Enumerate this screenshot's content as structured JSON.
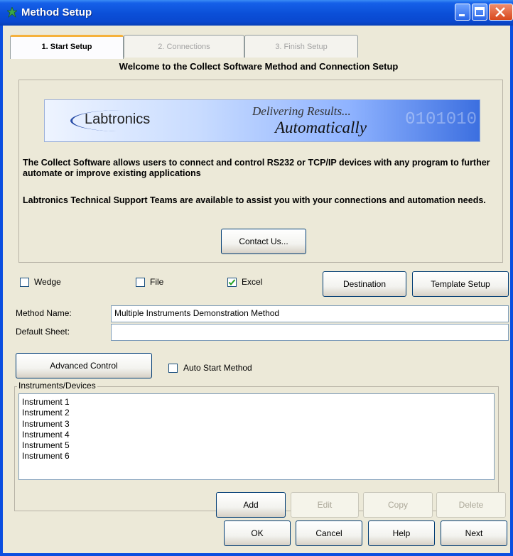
{
  "window": {
    "title": "Method Setup"
  },
  "tabs": [
    {
      "label": "1. Start Setup"
    },
    {
      "label": "2. Connections"
    },
    {
      "label": "3. Finish Setup"
    }
  ],
  "welcome": "Welcome to the Collect Software Method and Connection Setup",
  "banner": {
    "logo_text": "Labtronics",
    "tagline_1": "Delivering Results...",
    "tagline_2": "Automatically"
  },
  "info": {
    "paragraph_1": "The Collect Software allows users to connect and control RS232 or TCP/IP devices with any program to further automate or improve existing applications",
    "paragraph_2": "Labtronics Technical Support Teams are available to assist you with your connections and automation needs.",
    "contact_button": "Contact Us..."
  },
  "options": {
    "wedge_label": "Wedge",
    "wedge_checked": false,
    "file_label": "File",
    "file_checked": false,
    "excel_label": "Excel",
    "excel_checked": true,
    "destination_button": "Destination",
    "template_setup_button": "Template Setup"
  },
  "fields": {
    "method_name_label": "Method Name:",
    "method_name_value": "Multiple Instruments Demonstration Method",
    "default_sheet_label": "Default Sheet:",
    "default_sheet_value": ""
  },
  "advanced": {
    "advanced_button": "Advanced Control",
    "auto_start_label": "Auto Start Method",
    "auto_start_checked": false
  },
  "instruments": {
    "legend": "Instruments/Devices",
    "items": [
      "Instrument 1",
      "Instrument 2",
      "Instrument 3",
      "Instrument 4",
      "Instrument 5",
      "Instrument 6"
    ],
    "add_button": "Add",
    "edit_button": "Edit",
    "copy_button": "Copy",
    "delete_button": "Delete"
  },
  "footer": {
    "ok_button": "OK",
    "cancel_button": "Cancel",
    "help_button": "Help",
    "next_button": "Next"
  },
  "colors": {
    "titlebar": "#0a4ee0",
    "dialog_bg": "#ece9d8",
    "active_tab_accent": "#f5b13c",
    "check_mark": "#21a121"
  }
}
